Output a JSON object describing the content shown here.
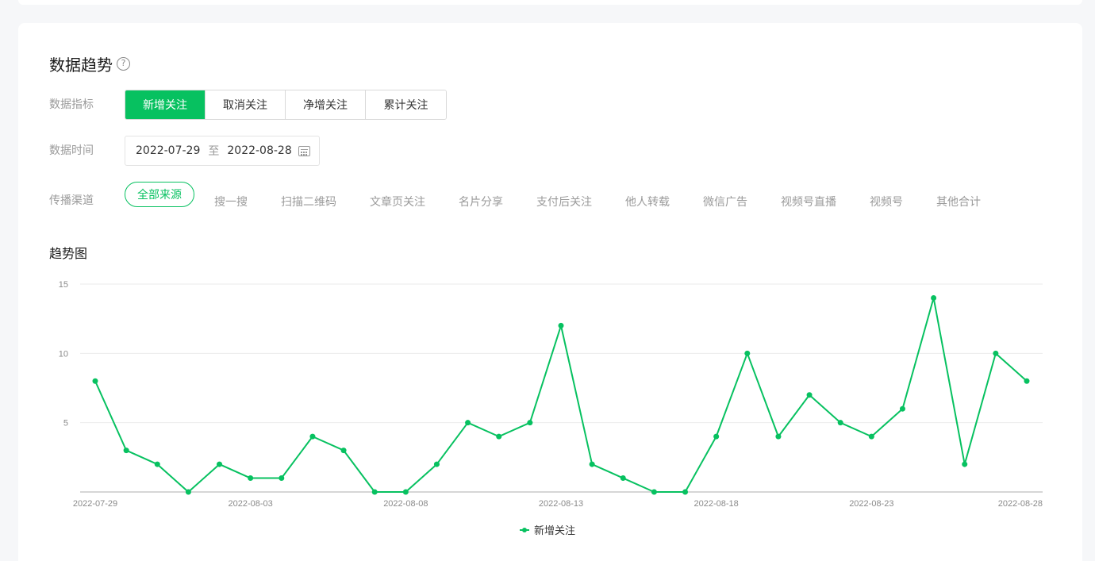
{
  "section_title": "数据趋势",
  "help_glyph": "?",
  "metric": {
    "label": "数据指标",
    "options": [
      "新增关注",
      "取消关注",
      "净增关注",
      "累计关注"
    ],
    "active_index": 0
  },
  "time": {
    "label": "数据时间",
    "start": "2022-07-29",
    "separator": "至",
    "end": "2022-08-28"
  },
  "channel": {
    "label": "传播渠道",
    "items": [
      "全部来源",
      "搜一搜",
      "扫描二维码",
      "文章页关注",
      "名片分享",
      "支付后关注",
      "他人转载",
      "微信广告",
      "视频号直播",
      "视频号",
      "其他合计"
    ],
    "active_index": 0
  },
  "chart_title": "趋势图",
  "colors": {
    "accent": "#07c160",
    "grid": "#ebebeb",
    "axis": "#c8c8c8",
    "tick_text": "#8a8a8a"
  },
  "chart_data": {
    "type": "line",
    "x": [
      "2022-07-29",
      "2022-07-30",
      "2022-07-31",
      "2022-08-01",
      "2022-08-02",
      "2022-08-03",
      "2022-08-04",
      "2022-08-05",
      "2022-08-06",
      "2022-08-07",
      "2022-08-08",
      "2022-08-09",
      "2022-08-10",
      "2022-08-11",
      "2022-08-12",
      "2022-08-13",
      "2022-08-14",
      "2022-08-15",
      "2022-08-16",
      "2022-08-17",
      "2022-08-18",
      "2022-08-19",
      "2022-08-20",
      "2022-08-21",
      "2022-08-22",
      "2022-08-23",
      "2022-08-24",
      "2022-08-25",
      "2022-08-26",
      "2022-08-27",
      "2022-08-28"
    ],
    "x_tick_labels": [
      "2022-07-29",
      "2022-08-03",
      "2022-08-08",
      "2022-08-13",
      "2022-08-18",
      "2022-08-23",
      "2022-08-28"
    ],
    "y_ticks": [
      5,
      10,
      15
    ],
    "ylim": [
      0,
      15
    ],
    "grid": true,
    "legend_position": "bottom-center",
    "series": [
      {
        "name": "新增关注",
        "values": [
          8,
          3,
          2,
          0,
          2,
          1,
          1,
          4,
          3,
          0,
          0,
          2,
          5,
          4,
          5,
          12,
          2,
          1,
          0,
          0,
          4,
          10,
          4,
          7,
          5,
          4,
          6,
          14,
          2,
          10,
          8
        ]
      }
    ]
  }
}
